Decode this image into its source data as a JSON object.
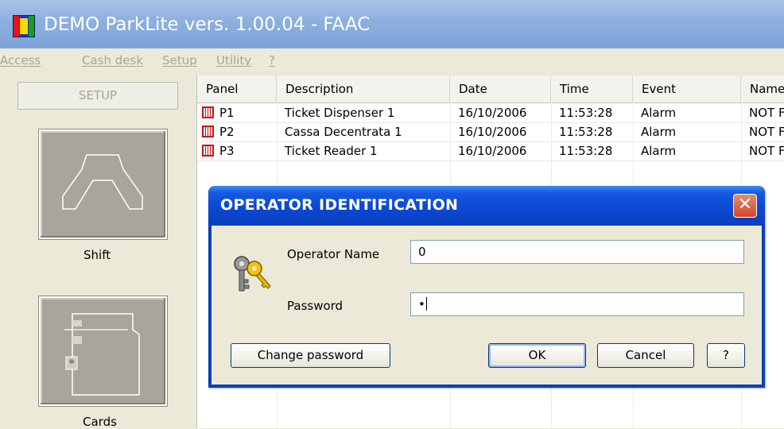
{
  "window": {
    "title": "DEMO ParkLite vers. 1.00.04 - FAAC"
  },
  "menu": {
    "items": [
      "Access",
      "Cash desk",
      "Setup",
      "Utility",
      "?"
    ]
  },
  "left_panel": {
    "tab_label": "SETUP",
    "buttons": [
      {
        "label": "Shift",
        "icon": "shift-hands-icon"
      },
      {
        "label": "Cards",
        "icon": "cards-icon"
      }
    ]
  },
  "grid": {
    "columns": [
      "Panel",
      "Description",
      "Date",
      "Time",
      "Event",
      "Name"
    ],
    "rows": [
      {
        "panel": "P1",
        "description": "Ticket Dispenser 1",
        "date": "16/10/2006",
        "time": "11:53:28",
        "event": "Alarm",
        "name": "NOT F"
      },
      {
        "panel": "P2",
        "description": "Cassa Decentrata 1",
        "date": "16/10/2006",
        "time": "11:53:28",
        "event": "Alarm",
        "name": "NOT F"
      },
      {
        "panel": "P3",
        "description": "Ticket Reader 1",
        "date": "16/10/2006",
        "time": "11:53:28",
        "event": "Alarm",
        "name": "NOT F"
      }
    ]
  },
  "dialog": {
    "title": "OPERATOR IDENTIFICATION",
    "close_symbol": "✕",
    "operator_name_label": "Operator Name",
    "operator_name_value": "0",
    "password_label": "Password",
    "password_value": "•",
    "change_password_label": "Change password",
    "ok_label": "OK",
    "cancel_label": "Cancel",
    "help_label": "?"
  },
  "colors": {
    "titlebar": "#8fb0df",
    "dialog_title": "#0b47d0",
    "alarm_icon": "#cc1111"
  }
}
